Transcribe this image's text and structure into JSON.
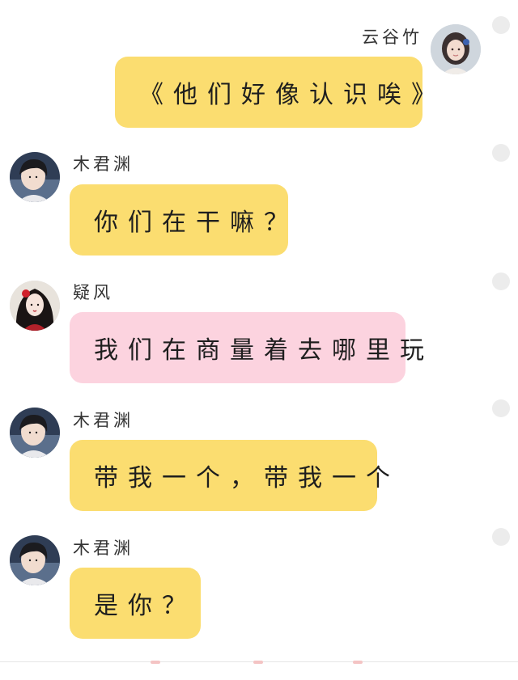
{
  "messages": [
    {
      "sender": "云谷竹",
      "text": "《他们好像认识唉》",
      "side": "right",
      "color": "yellow",
      "avatar": "girl-blue-hairpin-avatar"
    },
    {
      "sender": "木君渊",
      "text": "你们在干嘛？",
      "side": "left",
      "color": "yellow",
      "avatar": "boy-dark-hair-avatar"
    },
    {
      "sender": "疑风",
      "text": "我们在商量着去哪里玩",
      "side": "left",
      "color": "pink",
      "avatar": "girl-red-flower-avatar"
    },
    {
      "sender": "木君渊",
      "text": "带我一个，带我一个",
      "side": "left",
      "color": "yellow",
      "avatar": "boy-dark-hair-avatar"
    },
    {
      "sender": "木君渊",
      "text": "是你？",
      "side": "left",
      "color": "yellow",
      "avatar": "boy-dark-hair-avatar"
    }
  ],
  "colors": {
    "yellow_bubble": "#fbdd70",
    "pink_bubble": "#fcd3df",
    "status_dot": "#ececec",
    "background": "#ffffff"
  }
}
